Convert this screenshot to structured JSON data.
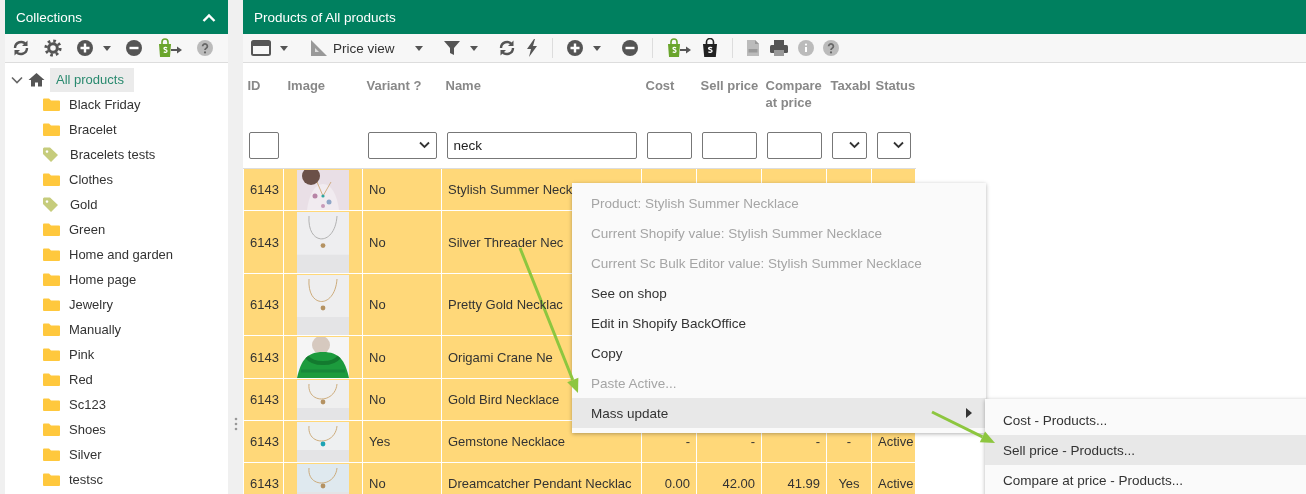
{
  "sidebar": {
    "title": "Collections",
    "tree": [
      {
        "label": "All products",
        "kind": "home",
        "selected": true,
        "expanded": true,
        "children": [
          {
            "label": "Black Friday",
            "kind": "folder",
            "selected": false
          },
          {
            "label": "Bracelet",
            "kind": "folder",
            "selected": false
          },
          {
            "label": "Bracelets tests",
            "kind": "tag",
            "selected": false
          },
          {
            "label": "Clothes",
            "kind": "folder",
            "selected": false
          },
          {
            "label": "Gold",
            "kind": "tag",
            "selected": false
          },
          {
            "label": "Green",
            "kind": "folder",
            "selected": false
          },
          {
            "label": "Home and garden",
            "kind": "folder",
            "selected": false
          },
          {
            "label": "Home page",
            "kind": "folder",
            "selected": false
          },
          {
            "label": "Jewelry",
            "kind": "folder",
            "selected": false
          },
          {
            "label": "Manually",
            "kind": "folder",
            "selected": false
          },
          {
            "label": "Pink",
            "kind": "folder",
            "selected": false
          },
          {
            "label": "Red",
            "kind": "folder",
            "selected": false
          },
          {
            "label": "Sc123",
            "kind": "folder",
            "selected": false
          },
          {
            "label": "Shoes",
            "kind": "folder",
            "selected": false
          },
          {
            "label": "Silver",
            "kind": "folder",
            "selected": false
          },
          {
            "label": "testsc",
            "kind": "folder",
            "selected": false
          }
        ]
      }
    ]
  },
  "main": {
    "title": "Products of All products",
    "view_label": "Price view",
    "columns": [
      {
        "label": "ID",
        "kind": "text"
      },
      {
        "label": "Image"
      },
      {
        "label": "Variant ?",
        "kind": "text"
      },
      {
        "label": "Name",
        "kind": "text"
      },
      {
        "label": "Cost",
        "kind": "number"
      },
      {
        "label": "Sell price",
        "kind": "number"
      },
      {
        "label": "Compare at price",
        "kind": "number"
      },
      {
        "label": "Taxabl",
        "kind": "center"
      },
      {
        "label": "Status",
        "kind": "text"
      }
    ],
    "filters": [
      {
        "kind": "input"
      },
      {
        "kind": "none"
      },
      {
        "kind": "select"
      },
      {
        "kind": "input",
        "value": "neck"
      },
      {
        "kind": "input"
      },
      {
        "kind": "input"
      },
      {
        "kind": "input"
      },
      {
        "kind": "select"
      },
      {
        "kind": "select"
      }
    ],
    "rows": [
      {
        "selected": true,
        "cells": [
          "6143",
          null,
          "No",
          "Stylish Summer Neck",
          null,
          null,
          null,
          null,
          null
        ]
      },
      {
        "selected": true,
        "cells": [
          "6143",
          null,
          "No",
          "Silver Threader Nec",
          null,
          null,
          null,
          null,
          null
        ]
      },
      {
        "selected": true,
        "cells": [
          "6143",
          null,
          "No",
          "Pretty Gold Necklac",
          null,
          null,
          null,
          null,
          null
        ]
      },
      {
        "selected": true,
        "cells": [
          "6143",
          null,
          "No",
          "Origami Crane Ne",
          null,
          null,
          null,
          null,
          null
        ]
      },
      {
        "selected": true,
        "cells": [
          "6143",
          null,
          "No",
          "Gold Bird Necklace",
          null,
          null,
          null,
          null,
          null
        ]
      },
      {
        "selected": true,
        "cells": [
          "6143",
          null,
          "Yes",
          "Gemstone Necklace",
          "-",
          "-",
          "-",
          "-",
          "Active"
        ]
      },
      {
        "selected": true,
        "cells": [
          "6143",
          null,
          "No",
          "Dreamcatcher Pendant Necklac",
          "0.00",
          "42.00",
          "41.99",
          "Yes",
          "Active"
        ]
      }
    ]
  },
  "context_menu": {
    "items": [
      {
        "label": "Product: Stylish Summer Necklace",
        "disabled": true,
        "selected": false
      },
      {
        "label": "Current Shopify value: Stylish Summer Necklace",
        "disabled": true,
        "selected": false
      },
      {
        "label": "Current Sc Bulk Editor value: Stylish Summer Necklace",
        "disabled": true,
        "selected": false
      },
      {
        "label": "See on shop",
        "disabled": false,
        "selected": false
      },
      {
        "label": "Edit in Shopify BackOffice",
        "disabled": false,
        "selected": false
      },
      {
        "label": "Copy",
        "disabled": false,
        "selected": false
      },
      {
        "label": "Paste Active...",
        "disabled": true,
        "selected": false
      },
      {
        "label": "Mass update",
        "disabled": false,
        "selected": true,
        "has_submenu": true
      }
    ],
    "submenu": [
      {
        "label": "Cost - Products...",
        "selected": false
      },
      {
        "label": "Sell price - Products...",
        "selected": true
      },
      {
        "label": "Compare at price - Products...",
        "selected": false
      }
    ]
  }
}
